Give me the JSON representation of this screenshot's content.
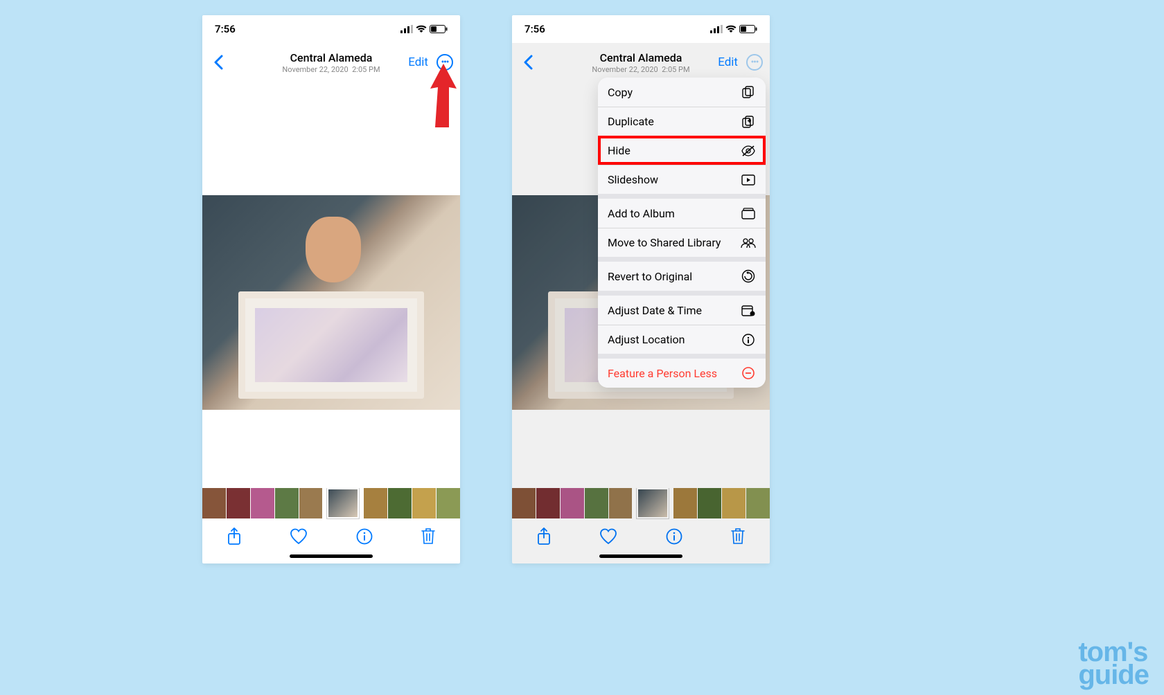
{
  "statusbar": {
    "time": "7:56"
  },
  "nav": {
    "title": "Central Alameda",
    "subtitle_date": "November 22, 2020",
    "subtitle_time": "2:05 PM",
    "edit": "Edit"
  },
  "menu": {
    "copy": "Copy",
    "duplicate": "Duplicate",
    "hide": "Hide",
    "slideshow": "Slideshow",
    "add_to_album": "Add to Album",
    "move_shared": "Move to Shared Library",
    "revert": "Revert to Original",
    "adjust_date": "Adjust Date & Time",
    "adjust_location": "Adjust Location",
    "feature_less": "Feature a Person Less"
  },
  "watermark": {
    "line1": "tom's",
    "line2": "guide"
  }
}
